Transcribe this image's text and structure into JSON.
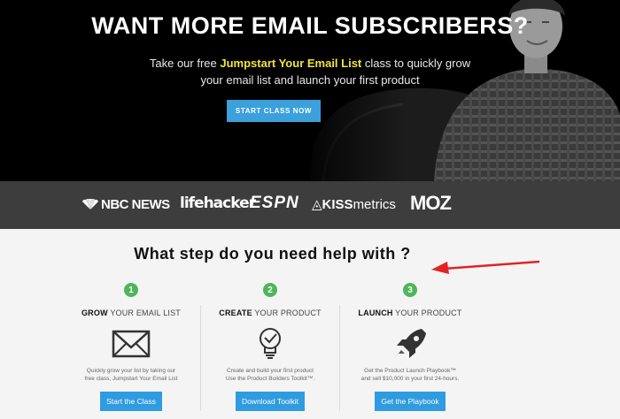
{
  "hero": {
    "title": "WANT MORE EMAIL SUBSCRIBERS?",
    "subtitle_pre": "Take our free ",
    "subtitle_highlight": "Jumpstart Your Email List",
    "subtitle_post_line1": " class to quickly grow",
    "subtitle_line2": "your email list and launch your first product",
    "cta_label": "START CLASS NOW",
    "highlight_color": "#f2e43a",
    "cta_color": "#3ba0dc"
  },
  "logos": {
    "nbc": "NBC NEWS",
    "lifehacker": "lifehacker",
    "espn": "ESPN",
    "kissmetrics_bold": "KISS",
    "kissmetrics_rest": "metrics",
    "moz": "MOZ"
  },
  "steps": {
    "title": "What step do you need help with ?",
    "items": [
      {
        "number": "1",
        "head_bold": "GROW",
        "head_rest": " YOUR EMAIL LIST",
        "icon": "envelope-icon",
        "desc_line1": "Quickly grow your list by taking our",
        "desc_line2": "free class, Jumpstart Your Email List",
        "button": "Start the Class"
      },
      {
        "number": "2",
        "head_bold": "CREATE",
        "head_rest": " YOUR PRODUCT",
        "icon": "lightbulb-icon",
        "desc_line1": "Create and build your first product",
        "desc_line2": "Use the Product Builders Toolkit™.",
        "button": "Download Toolkit"
      },
      {
        "number": "3",
        "head_bold": "LAUNCH",
        "head_rest": " YOUR PRODUCT",
        "icon": "rocket-icon",
        "desc_line1": "Get the Product Launch Playbook™",
        "desc_line2": "and sell $10,000 in your first 24-hours.",
        "button": "Get the Playbook"
      }
    ],
    "number_color": "#4eb55a",
    "button_color": "#2f9be0",
    "arrow_color": "#e02424"
  }
}
